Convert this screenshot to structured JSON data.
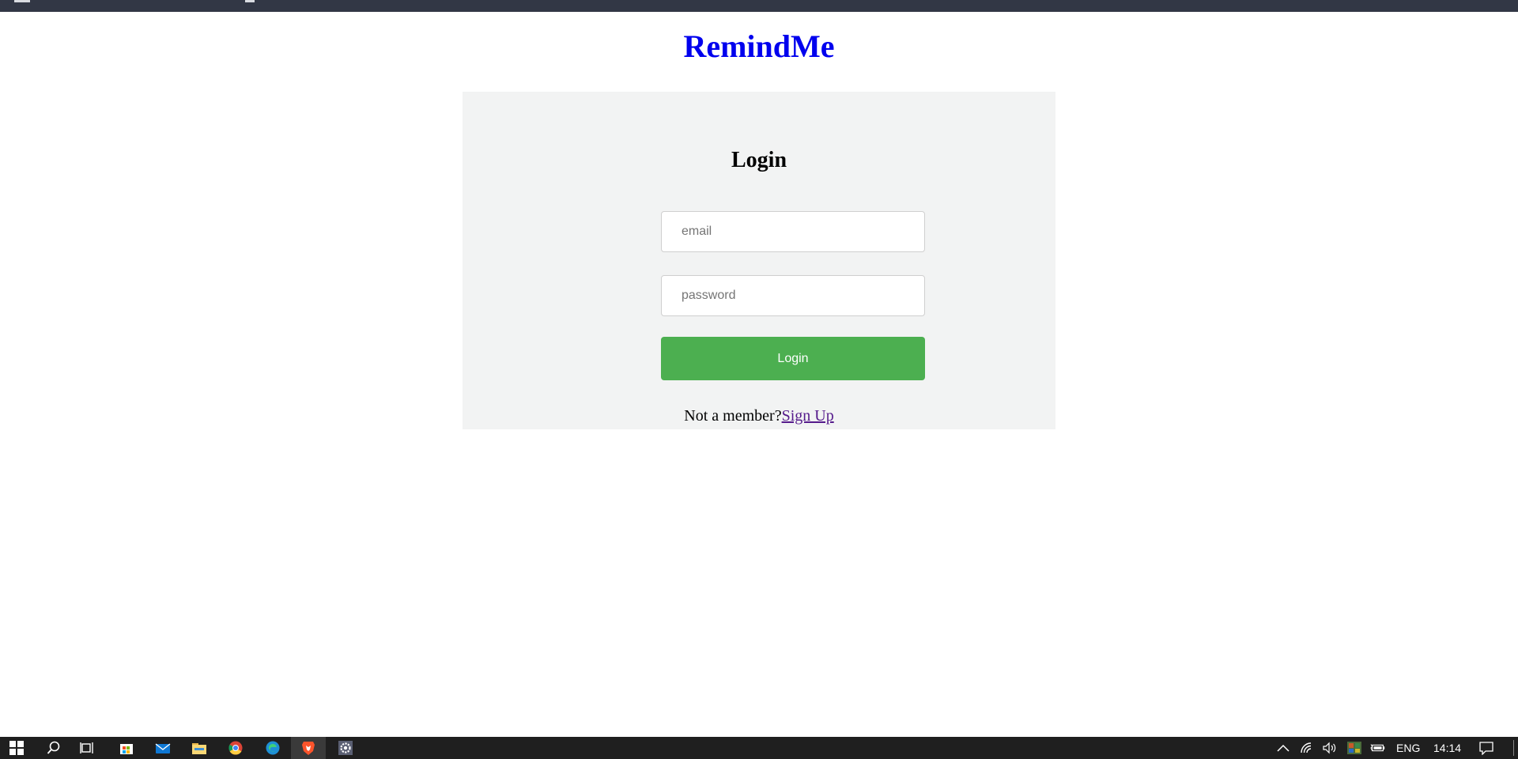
{
  "app": {
    "title": "RemindMe"
  },
  "login": {
    "heading": "Login",
    "email_placeholder": "email",
    "password_placeholder": "password",
    "button_label": "Login",
    "signup_prompt": "Not a member?",
    "signup_link": "Sign Up"
  },
  "taskbar": {
    "icons": [
      "windows-start-icon",
      "search-icon",
      "task-view-icon",
      "store-icon",
      "mail-icon",
      "file-explorer-icon",
      "chrome-icon",
      "edge-icon",
      "brave-icon",
      "settings-gear-icon"
    ],
    "active_app": "brave-icon",
    "tray": {
      "icons": [
        "chevron-up-icon",
        "wifi-icon",
        "volume-icon",
        "color-app-icon",
        "battery-icon",
        "notification-icon"
      ],
      "language": "ENG",
      "time": "14:14"
    }
  },
  "colors": {
    "title": "#0000ee",
    "button": "#4caf50",
    "panel": "#f2f3f3",
    "link": "#551a8b",
    "browser_bar": "#323745",
    "taskbar": "#1f1f1f"
  }
}
